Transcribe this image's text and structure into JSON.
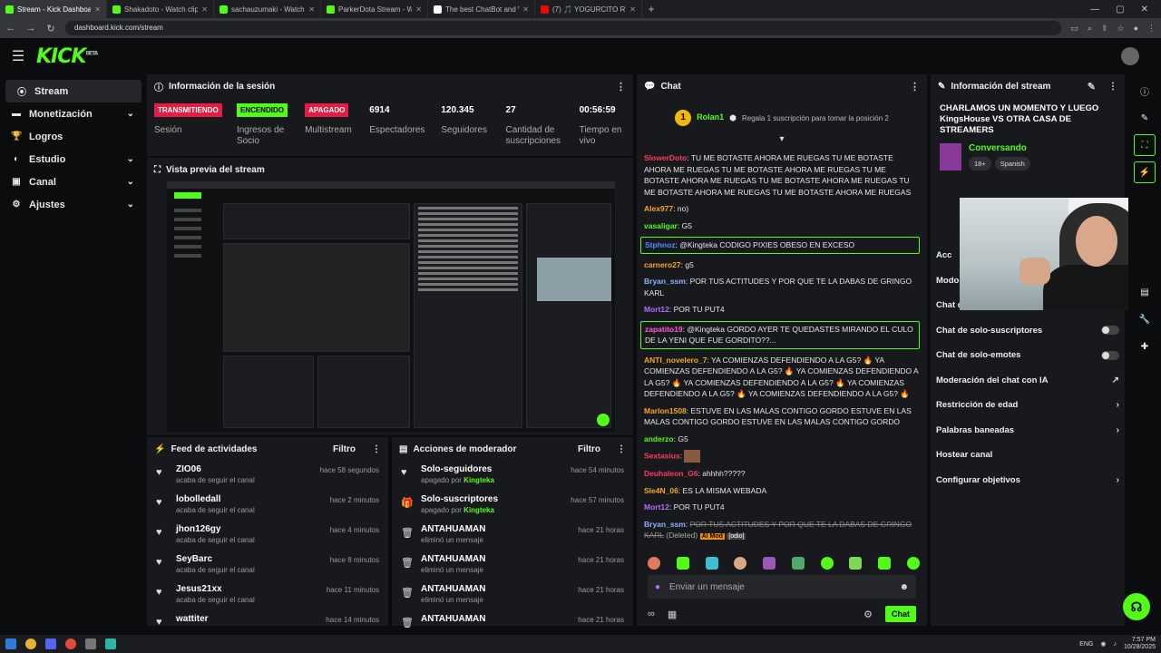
{
  "browser": {
    "tabs": [
      {
        "title": "Stream - Kick Dashboard",
        "color": "#53fc18"
      },
      {
        "title": "Shakadoto - Watch clips on Kick",
        "color": "#53fc18"
      },
      {
        "title": "sachauzumaki - Watch clips on Kick",
        "color": "#53fc18"
      },
      {
        "title": "ParkerDota Stream - Watch Live",
        "color": "#53fc18"
      },
      {
        "title": "The best ChatBot and Widgets",
        "color": "#ffffff"
      },
      {
        "title": "(7) 🎵 YOGURCITO REMIX | ...",
        "color": "#ff0000"
      }
    ],
    "url": "dashboard.kick.com/stream"
  },
  "header": {
    "logo": "KICK",
    "beta": "BETA"
  },
  "sidebar": {
    "items": [
      {
        "label": "Stream",
        "icon": "broadcast-icon",
        "glyph": "((·))",
        "chevron": false
      },
      {
        "label": "Monetización",
        "icon": "money-icon",
        "glyph": "▬",
        "chevron": true
      },
      {
        "label": "Logros",
        "icon": "trophy-icon",
        "glyph": "🏆",
        "chevron": false
      },
      {
        "label": "Estudio",
        "icon": "studio-icon",
        "glyph": "◐",
        "chevron": true
      },
      {
        "label": "Canal",
        "icon": "channel-icon",
        "glyph": "▣",
        "chevron": true
      },
      {
        "label": "Ajustes",
        "icon": "gear-icon",
        "glyph": "⚙",
        "chevron": true
      }
    ]
  },
  "session": {
    "title": "Información de la sesión",
    "stats": [
      {
        "top": "TRANSMITIENDO",
        "bottom": "Sesión",
        "kind": "red"
      },
      {
        "top": "ENCENDIDO",
        "bottom": "Ingresos de Socio",
        "kind": "green"
      },
      {
        "top": "APAGADO",
        "bottom": "Multistream",
        "kind": "red"
      },
      {
        "top": "6914",
        "bottom": "Espectadores",
        "kind": "num"
      },
      {
        "top": "120.345",
        "bottom": "Seguidores",
        "kind": "num"
      },
      {
        "top": "27",
        "bottom": "Cantidad de suscripciones",
        "kind": "num"
      },
      {
        "top": "00:56:59",
        "bottom": "Tiempo en vivo",
        "kind": "num"
      }
    ]
  },
  "preview": {
    "title": "Vista previa del stream"
  },
  "feed": {
    "title": "Feed de actividades",
    "filter": "Filtro",
    "items": [
      {
        "name": "ZIO06",
        "sub": "acaba de seguir el canal",
        "time": "hace 58 segundos"
      },
      {
        "name": "lobolledall",
        "sub": "acaba de seguir el canal",
        "time": "hace 2 minutos"
      },
      {
        "name": "jhon126gy",
        "sub": "acaba de seguir el canal",
        "time": "hace 4 minutos"
      },
      {
        "name": "SeyBarc",
        "sub": "acaba de seguir el canal",
        "time": "hace 8 minutos"
      },
      {
        "name": "Jesus21xx",
        "sub": "acaba de seguir el canal",
        "time": "hace 11 minutos"
      },
      {
        "name": "wattiter",
        "sub": "",
        "time": "hace 14 minutos"
      }
    ]
  },
  "mod": {
    "title": "Acciones de moderador",
    "filter": "Filtro",
    "items": [
      {
        "name": "Solo-seguidores",
        "sub": "apagado por",
        "by": "Kingteka",
        "time": "hace 54 minutos",
        "icon": "heart-icon",
        "glyph": "♥"
      },
      {
        "name": "Solo-suscriptores",
        "sub": "apagado por",
        "by": "Kingteka",
        "time": "hace 57 minutos",
        "icon": "gift-icon",
        "glyph": "🎁"
      },
      {
        "name": "ANTAHUAMAN",
        "sub": "eliminó un mensaje",
        "by": "",
        "time": "hace 21 horas",
        "icon": "trash-icon",
        "glyph": "🗑"
      },
      {
        "name": "ANTAHUAMAN",
        "sub": "eliminó un mensaje",
        "by": "",
        "time": "hace 21 horas",
        "icon": "trash-icon",
        "glyph": "🗑"
      },
      {
        "name": "ANTAHUAMAN",
        "sub": "eliminó un mensaje",
        "by": "",
        "time": "hace 21 horas",
        "icon": "trash-icon",
        "glyph": "🗑"
      },
      {
        "name": "ANTAHUAMAN",
        "sub": "",
        "by": "",
        "time": "hace 21 horas",
        "icon": "trash-icon",
        "glyph": "🗑"
      }
    ]
  },
  "chat": {
    "title": "Chat",
    "pinned": {
      "rank": "1",
      "name": "Rolan1",
      "text": "Regala 1 suscripción para tomar la posición 2"
    },
    "messages": [
      {
        "user": "SlowerDoto",
        "color": "#ff3b5c",
        "text": "TU ME BOTASTE AHORA ME RUEGAS TU ME BOTASTE AHORA ME RUEGAS TU ME BOTASTE AHORA ME RUEGAS TU ME BOTASTE AHORA ME RUEGAS TU ME BOTASTE AHORA ME RUEGAS TU ME BOTASTE AHORA ME RUEGAS TU ME BOTASTE AHORA ME RUEGAS",
        "hl": false
      },
      {
        "user": "Alex977",
        "color": "#f5a623",
        "text": "no)",
        "hl": false
      },
      {
        "user": "vasaligar",
        "color": "#53fc18",
        "text": "G5",
        "hl": false
      },
      {
        "user": "Stphnoz",
        "color": "#4f8bff",
        "text": "@Kingteka CODIGO PIXIES OBESO EN EXCESO",
        "hl": true
      },
      {
        "user": "carnero27",
        "color": "#f5a623",
        "text": "g5",
        "hl": false
      },
      {
        "user": "Bryan_ssm",
        "color": "#8ab4ff",
        "text": "POR TUS ACTITUDES Y POR QUE TE LA DABAS DE GRINGO KARL",
        "hl": false
      },
      {
        "user": "Mort12",
        "color": "#b56cff",
        "text": "POR TU PUT4",
        "hl": false
      },
      {
        "user": "zapatito19",
        "color": "#ff5ccd",
        "text": "@Kingteka GORDO AYER TE QUEDASTES MIRANDO EL CULO DE LA YENI QUE FUE GORDITO??...",
        "hl": true
      },
      {
        "user": "ANTI_novelero_7",
        "color": "#f5a623",
        "text": "YA COMIENZAS DEFENDIENDO A LA G5? 🔥 YA COMIENZAS DEFENDIENDO A LA G5? 🔥 YA COMIENZAS DEFENDIENDO A LA G5? 🔥 YA COMIENZAS DEFENDIENDO A LA G5? 🔥 YA COMIENZAS DEFENDIENDO A LA G5? 🔥 YA COMIENZAS DEFENDIENDO A LA G5? 🔥",
        "hl": false
      },
      {
        "user": "Marlon1508",
        "color": "#f5a623",
        "text": "ESTUVE EN LAS MALAS CONTIGO GORDO ESTUVE EN LAS MALAS CONTIGO GORDO ESTUVE EN LAS MALAS CONTIGO GORDO",
        "hl": false
      },
      {
        "user": "anderzo",
        "color": "#53fc18",
        "text": "G5",
        "hl": false
      },
      {
        "user": "Sextasius",
        "color": "#ff3b5c",
        "text": "",
        "emote": true,
        "hl": false
      },
      {
        "user": "Deuhaleon_G6",
        "color": "#ff3b5c",
        "text": "ahhhh?????",
        "hl": false
      },
      {
        "user": "Sle4N_06",
        "color": "#f5a623",
        "text": "ES LA MISMA WEBADA",
        "hl": false
      },
      {
        "user": "Mort12",
        "color": "#b56cff",
        "text": "POR TU PUT4",
        "hl": false
      }
    ],
    "deleted": {
      "user": "Bryan_ssm",
      "color": "#8ab4ff",
      "text": "POR TUS ACTITUDES Y POR QUE TE LA DABAS DE GRINGO KARL",
      "note": "(Deleted)",
      "amod": "AI Mod",
      "tag": "[odio]"
    },
    "emote_colors": [
      "#e07a5f",
      "#53fc18",
      "#3fbfd5",
      "#d9a88a",
      "#9b59b6",
      "#53a86b",
      "#53fc18",
      "#7ed957",
      "#53fc18",
      "#53fc18"
    ],
    "input_placeholder": "Enviar un mensaje",
    "send": "Chat"
  },
  "info": {
    "title": "Información del stream",
    "stream_title": "CHARLAMOS UN MOMENTO Y LUEGO KingsHouse VS OTRA CASA DE STREAMERS",
    "category": "Conversando",
    "tags": [
      "18+",
      "Spanish"
    ],
    "acc_head": "Acc",
    "rows": [
      {
        "label": "Modo",
        "right": ""
      },
      {
        "label": "Chat d",
        "right": ""
      },
      {
        "label": "Chat de solo-suscriptores",
        "right": "toggle"
      },
      {
        "label": "Chat de solo-emotes",
        "right": "toggle"
      },
      {
        "label": "Moderación del chat con IA",
        "right": "↗"
      },
      {
        "label": "Restricción de edad",
        "right": "›"
      },
      {
        "label": "Palabras baneadas",
        "right": "›"
      },
      {
        "label": "Hostear canal",
        "right": ""
      },
      {
        "label": "Configurar objetivos",
        "right": "›"
      }
    ]
  },
  "taskbar": {
    "lang": "ENG",
    "time": "7:57 PM",
    "date": "10/28/2025"
  }
}
